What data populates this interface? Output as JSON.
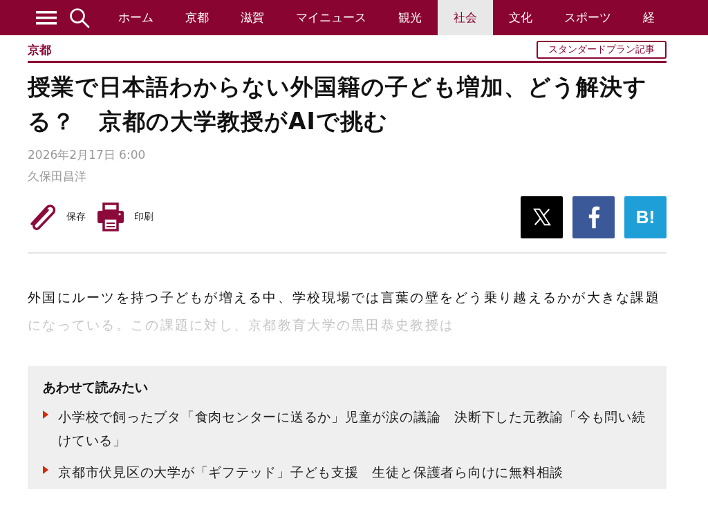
{
  "nav": {
    "items": [
      {
        "label": "ホーム",
        "selected": false
      },
      {
        "label": "京都",
        "selected": false
      },
      {
        "label": "滋賀",
        "selected": false
      },
      {
        "label": "マイニュース",
        "selected": false
      },
      {
        "label": "観光",
        "selected": false
      },
      {
        "label": "社会",
        "selected": true
      },
      {
        "label": "文化",
        "selected": false
      },
      {
        "label": "スポーツ",
        "selected": false
      },
      {
        "label": "経",
        "selected": false
      }
    ]
  },
  "article": {
    "category": "京都",
    "badge": "スタンダードプラン記事",
    "title": "授業で日本語わからない外国籍の子ども増加、どう解決する？　京都の大学教授がAIで挑む",
    "date": "2026年2月17日 6:00",
    "author": "久保田昌洋",
    "actions": [
      {
        "kind": "save",
        "label": "保存"
      },
      {
        "kind": "print",
        "label": "印刷"
      }
    ],
    "share": [
      {
        "kind": "x"
      },
      {
        "kind": "facebook"
      },
      {
        "kind": "hatena",
        "label": "B!"
      }
    ],
    "lead": "外国にルーツを持つ子どもが増える中、学校現場では言葉の壁をどう乗り越えるかが大きな課題になっている。この課題に対し、京都教育大学の黒田恭史教授は"
  },
  "related": {
    "heading": "あわせて読みたい",
    "items": [
      "小学校で飼ったブタ「食肉センターに送るか」児童が涙の議論　決断下した元教諭「今も問い続けている」",
      "京都市伏見区の大学が「ギフテッド」子ども支援　生徒と保護者ら向けに無料相談"
    ]
  }
}
